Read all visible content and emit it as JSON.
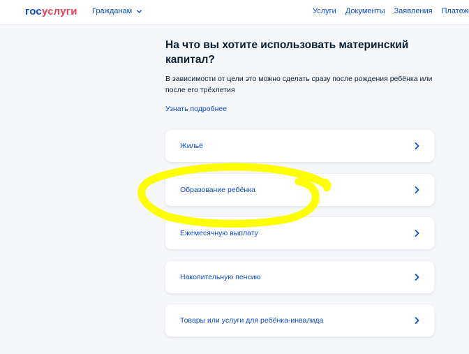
{
  "header": {
    "logo_part1": "гос",
    "logo_part2": "услуги",
    "audience": "Гражданам",
    "nav": [
      "Услуги",
      "Документы",
      "Заявления",
      "Платежи"
    ]
  },
  "main": {
    "title": "На что вы хотите использовать материнский капитал?",
    "subtitle": "В зависимости от цели это можно сделать сразу после рождения ребёнка или после его трёхлетия",
    "more_link": "Узнать подробнее",
    "options": [
      "Жильё",
      "Образование ребёнка",
      "Ежемесячную выплату",
      "Накопительную пенсию",
      "Товары или услуги для ребёнка-инвалида"
    ]
  },
  "colors": {
    "accent": "#0d4cd3",
    "logo_red": "#ee3f58",
    "annotation": "#ffff00"
  }
}
